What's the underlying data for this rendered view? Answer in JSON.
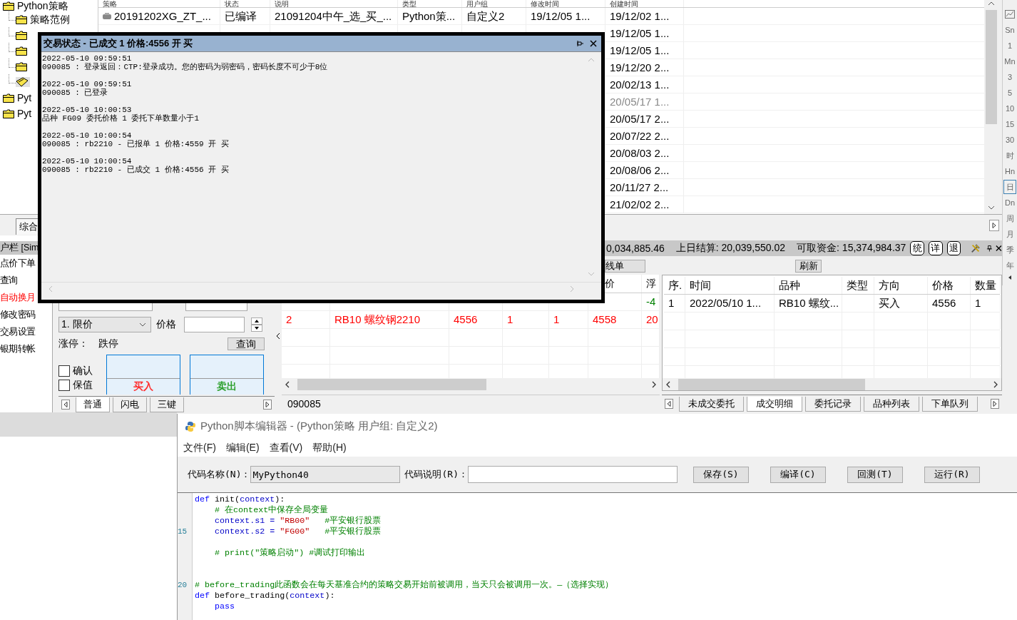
{
  "strategy_tree": {
    "items": [
      {
        "label": "Python策略",
        "kind": "folder",
        "selected": false,
        "children": [
          {
            "label": "策略范例",
            "kind": "folder",
            "selected": false
          },
          {
            "kind": "folder",
            "selected": false
          },
          {
            "kind": "folder",
            "selected": false
          },
          {
            "kind": "folder",
            "selected": false
          },
          {
            "kind": "open",
            "selected": true
          }
        ]
      },
      {
        "label": "Pyt",
        "kind": "folder",
        "selected": false
      },
      {
        "label": "Pyt",
        "kind": "folder",
        "selected": false
      }
    ]
  },
  "strategy_table": {
    "columns": [
      "策略",
      "状态",
      "说明",
      "类型",
      "用户组",
      "修改时间",
      "创建时间"
    ],
    "rows": [
      {
        "disabled": false,
        "cells": [
          "20191202XG_ZT_...",
          "已编译",
          "21091204中午_选_买_...",
          "Python策...",
          "自定义2",
          "19/12/05 1...",
          "19/12/02 1..."
        ]
      },
      {
        "disabled": false,
        "cells": [
          null,
          null,
          null,
          null,
          null,
          null,
          "19/12/05 1..."
        ]
      },
      {
        "disabled": false,
        "cells": [
          null,
          null,
          null,
          null,
          null,
          null,
          "19/12/05 1..."
        ]
      },
      {
        "disabled": false,
        "cells": [
          null,
          null,
          null,
          null,
          null,
          null,
          "19/12/20 2..."
        ]
      },
      {
        "disabled": false,
        "cells": [
          null,
          null,
          null,
          null,
          null,
          null,
          "20/02/13 1..."
        ]
      },
      {
        "disabled": true,
        "cells": [
          null,
          null,
          null,
          null,
          null,
          null,
          "20/05/17 1..."
        ]
      },
      {
        "disabled": false,
        "cells": [
          null,
          null,
          null,
          null,
          null,
          null,
          "20/05/17 2..."
        ]
      },
      {
        "disabled": false,
        "cells": [
          null,
          null,
          null,
          null,
          null,
          null,
          "20/07/22 2..."
        ]
      },
      {
        "disabled": false,
        "cells": [
          null,
          null,
          null,
          null,
          null,
          null,
          "20/08/03 2..."
        ]
      },
      {
        "disabled": false,
        "cells": [
          null,
          null,
          null,
          null,
          null,
          null,
          "20/08/06 2..."
        ]
      },
      {
        "disabled": false,
        "cells": [
          null,
          null,
          null,
          null,
          null,
          null,
          "20/11/27 2..."
        ]
      },
      {
        "disabled": false,
        "cells": [
          null,
          null,
          null,
          null,
          null,
          null,
          "21/02/02 2..."
        ]
      }
    ]
  },
  "period_bar": {
    "items": [
      {
        "label": "Sn",
        "selected": false
      },
      {
        "label": "1",
        "selected": false
      },
      {
        "label": "Mn",
        "selected": false
      },
      {
        "label": "3",
        "selected": false
      },
      {
        "label": "5",
        "selected": false
      },
      {
        "label": "10",
        "selected": false
      },
      {
        "label": "15",
        "selected": false
      },
      {
        "label": "30",
        "selected": false
      },
      {
        "label": "时",
        "selected": false
      },
      {
        "label": "Hn",
        "selected": false
      },
      {
        "label": "日",
        "selected": true
      },
      {
        "label": "Dn",
        "selected": false
      },
      {
        "label": "周",
        "selected": false
      },
      {
        "label": "月",
        "selected": false
      },
      {
        "label": "季",
        "selected": false
      },
      {
        "label": "年",
        "selected": false
      }
    ]
  },
  "trade_dialog": {
    "title": "交易状态 - 已成交 1 价格:4556 开 买",
    "log": [
      {
        "time": "2022-05-10 09:59:51",
        "message": "090085 : 登录返回：CTP:登录成功。您的密码为弱密码，密码长度不可少于8位"
      },
      {
        "time": "2022-05-10 09:59:51",
        "message": "090085 : 已登录"
      },
      {
        "time": "2022-05-10 10:00:53",
        "message": "品种 FG09 委托价格 1 委托下单数量小于1"
      },
      {
        "time": "2022-05-10 10:00:54",
        "message": "090085 : rb2210 - 已报单 1 价格:4559 开 买"
      },
      {
        "time": "2022-05-10 10:00:54",
        "message": "090085 : rb2210 - 已成交 1 价格:4556 开 买"
      }
    ]
  },
  "left_panel": {
    "tab": "综合",
    "header": "户栏 [Sim",
    "items": [
      {
        "label": "点价下单",
        "highlighted": false
      },
      {
        "label": "查询",
        "highlighted": false
      },
      {
        "label": "自动换月",
        "highlighted": true
      },
      {
        "label": "修改密码",
        "highlighted": false
      },
      {
        "label": "交易设置",
        "highlighted": false
      },
      {
        "label": "银期转帐",
        "highlighted": false
      }
    ]
  },
  "order_panel": {
    "order_type": "1. 限价",
    "price_label": "价格",
    "limit_up_label": "涨停：",
    "limit_down_label": "跌停",
    "query_button": "查询",
    "checkboxes": [
      {
        "label": "确认",
        "checked": false
      },
      {
        "label": "保值",
        "checked": false
      }
    ],
    "buy_button": "买入",
    "sell_button": "卖出",
    "tabs": [
      {
        "label": "普通",
        "selected": true
      },
      {
        "label": "闪电",
        "selected": false
      },
      {
        "label": "三键",
        "selected": false
      }
    ]
  },
  "position_panel": {
    "button": "线单",
    "headers": [
      "价",
      "浮"
    ],
    "rows": [
      {
        "color": "#008000",
        "cells": [
          null,
          null,
          null,
          null,
          null,
          null,
          "-4"
        ]
      },
      {
        "color": "#ff0000",
        "cells": [
          "2",
          "RB10 螺纹钢2210",
          "4556",
          "1",
          "1",
          "4558",
          "20"
        ]
      }
    ],
    "account": "090085"
  },
  "account_bar": {
    "items": [
      "0,034,885.46",
      "上日结算: 20,039,550.02",
      "可取资金: 15,374,984.37"
    ],
    "buttons": [
      "统",
      "详",
      "退"
    ]
  },
  "trade_panel": {
    "refresh_button": "刷新",
    "columns": [
      "序.",
      "时间",
      "品种",
      "类型",
      "方向",
      "价格",
      "数量"
    ],
    "rows": [
      [
        "1",
        "2022/05/10 1...",
        "RB10 螺纹...",
        null,
        "买入",
        "4556",
        "1"
      ]
    ],
    "tabs": [
      {
        "label": "未成交委托",
        "selected": false
      },
      {
        "label": "成交明细",
        "selected": true
      },
      {
        "label": "委托记录",
        "selected": false
      },
      {
        "label": "品种列表",
        "selected": false
      },
      {
        "label": "下单队列",
        "selected": false
      }
    ]
  },
  "editor": {
    "title": "Python脚本编辑器 - (Python策略 用户组: 自定义2)",
    "menu": [
      "文件(F)",
      "编辑(E)",
      "查看(V)",
      "帮助(H)"
    ],
    "name_label": "代码名称(N)：",
    "name_value": "MyPython40",
    "desc_label": "代码说明(R)：",
    "buttons": [
      "保存(S)",
      "编译(C)",
      "回测(T)",
      "运行(R)"
    ],
    "lines": [
      {
        "tokens": [
          {
            "kind": "keyword",
            "text": "def"
          },
          {
            "kind": "plain",
            "text": " init("
          },
          {
            "kind": "name",
            "text": "context"
          },
          {
            "kind": "plain",
            "text": "):"
          }
        ]
      },
      {
        "tokens": [
          {
            "kind": "comment",
            "text": "    # 在context中保存全局变量"
          }
        ]
      },
      {
        "tokens": [
          {
            "kind": "name",
            "text": "    context.s1 = "
          },
          {
            "kind": "string",
            "text": "\"RB00\""
          },
          {
            "kind": "comment",
            "text": "   #平安银行股票"
          }
        ]
      },
      {
        "number": "15",
        "tokens": [
          {
            "kind": "name",
            "text": "    context.s2 = "
          },
          {
            "kind": "string",
            "text": "\"FG00\""
          },
          {
            "kind": "comment",
            "text": "   #平安银行股票"
          }
        ]
      },
      {
        "kind": "blank"
      },
      {
        "tokens": [
          {
            "kind": "comment",
            "text": "    # print(\"策略启动\") #调试打印输出"
          }
        ]
      },
      {
        "kind": "blank"
      },
      {
        "kind": "blank"
      },
      {
        "number": "20",
        "tokens": [
          {
            "kind": "comment",
            "text": "# before_trading此函数会在每天基准合约的策略交易开始前被调用，当天只会被调用一次。—（选择实现）"
          }
        ]
      },
      {
        "tokens": [
          {
            "kind": "keyword",
            "text": "def"
          },
          {
            "kind": "plain",
            "text": " before_trading("
          },
          {
            "kind": "name",
            "text": "context"
          },
          {
            "kind": "plain",
            "text": "):"
          }
        ]
      },
      {
        "tokens": [
          {
            "kind": "keyword",
            "text": "    pass"
          }
        ]
      }
    ]
  }
}
